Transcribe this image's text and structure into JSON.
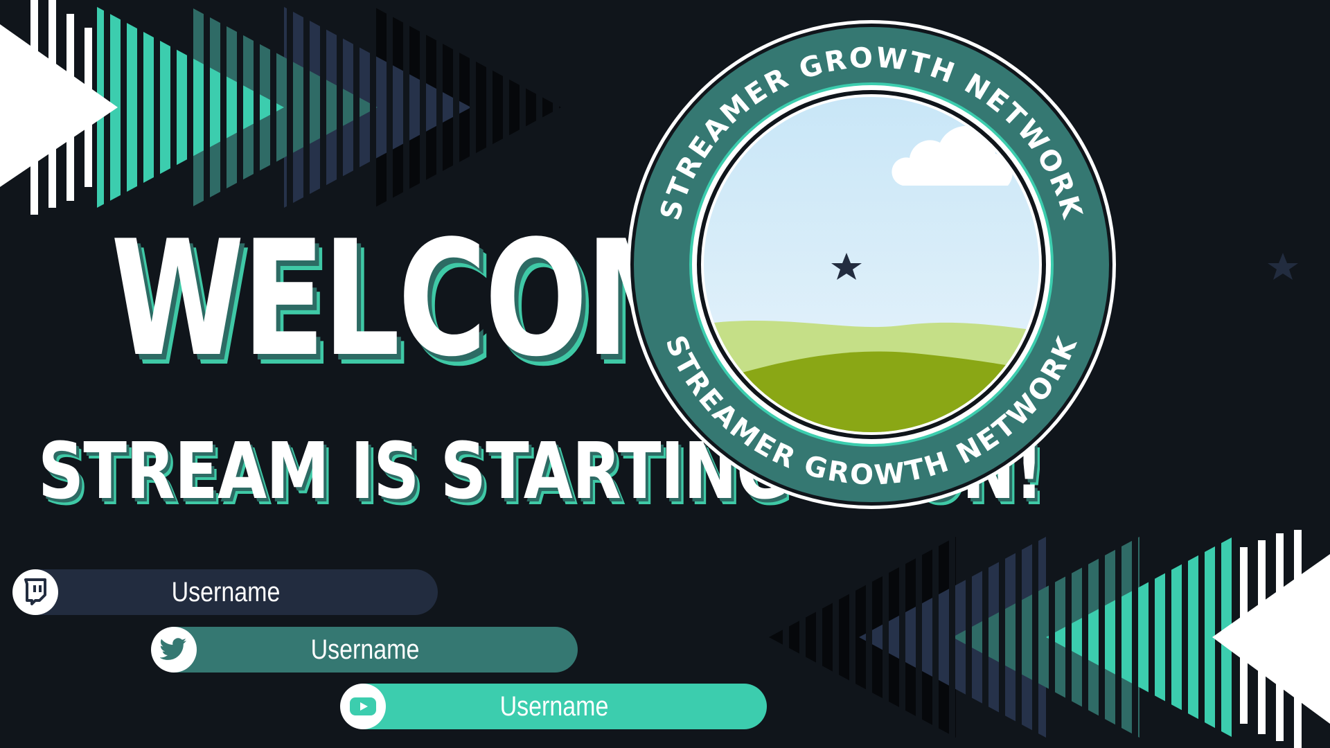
{
  "colors": {
    "background": "#10151b",
    "accent_teal": "#3ccdae",
    "dark_teal": "#357872",
    "navy": "#222c3f",
    "white": "#ffffff"
  },
  "title": "WELCOME!",
  "subtitle": "STREAM IS STARTING SOON!",
  "badge": {
    "ring_text_top": "STREAMER GROWTH NETWORK",
    "ring_text_bottom": "STREAMER GROWTH NETWORK",
    "icons": [
      "star-icon",
      "star-icon"
    ]
  },
  "socials": [
    {
      "platform_icon": "twitch-icon",
      "username": "Username"
    },
    {
      "platform_icon": "twitter-icon",
      "username": "Username"
    },
    {
      "platform_icon": "youtube-icon",
      "username": "Username"
    }
  ]
}
